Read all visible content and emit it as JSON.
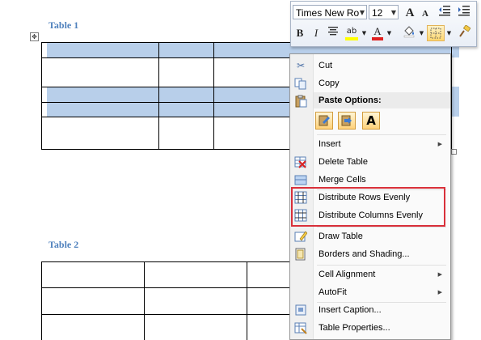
{
  "document": {
    "table1_caption": "Table 1",
    "table2_caption": "Table 2",
    "table_move_handle": "✥"
  },
  "mini_toolbar": {
    "font_name": "Times New Roman",
    "font_size": "12",
    "grow_font": "A",
    "shrink_font": "A",
    "bold": "B",
    "italic": "I",
    "font_color": "A",
    "highlight": "ab"
  },
  "context_menu": {
    "cut": "Cut",
    "copy": "Copy",
    "paste_options_header": "Paste Options:",
    "paste_keep_text_only": "A",
    "insert": "Insert",
    "delete_table": "Delete Table",
    "merge_cells": "Merge Cells",
    "distribute_rows": "Distribute Rows Evenly",
    "distribute_columns": "Distribute Columns Evenly",
    "draw_table": "Draw Table",
    "borders_shading": "Borders and Shading...",
    "cell_alignment": "Cell Alignment",
    "autofit": "AutoFit",
    "insert_caption": "Insert Caption...",
    "table_properties": "Table Properties..."
  },
  "colors": {
    "selection_highlight": "#b8cfea",
    "caption_blue": "#4f81bd",
    "annotation_red": "#d9303a"
  }
}
